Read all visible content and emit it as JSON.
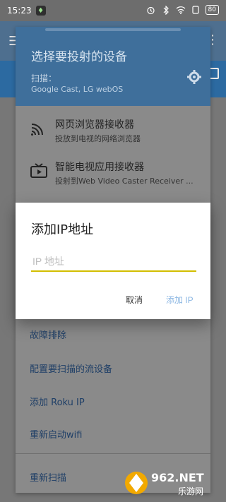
{
  "status_bar": {
    "time": "15:23",
    "notification_icon": "app-icon",
    "icons": [
      "alarm-icon",
      "bluetooth-icon",
      "wifi-icon",
      "sim-icon"
    ],
    "battery": "80"
  },
  "app_bar": {
    "menu_icon": "menu-icon",
    "more_icon": "more-vert-icon"
  },
  "sheet": {
    "title": "选择要投射的设备",
    "scan_label": "扫描：",
    "scan_value": "Google Cast, LG webOS",
    "receivers": [
      {
        "title": "网页浏览器接收器",
        "subtitle": "投放到电视的网络浏览器",
        "icon": "cast-icon"
      },
      {
        "title": "智能电视应用接收器",
        "subtitle": "投射到Web Video Caster Receiver ...",
        "icon": "tv-icon"
      }
    ],
    "options": [
      "故障排除",
      "配置要扫描的流设备",
      "添加 Roku IP",
      "重新启动wifi"
    ],
    "rescan": "重新扫描"
  },
  "dialog": {
    "title": "添加IP地址",
    "input_placeholder": "IP 地址",
    "input_value": "",
    "cancel_label": "取消",
    "add_label": "添加 IP",
    "accent": "#d2be00"
  },
  "watermark": {
    "brand": "962.NET",
    "sub": "乐游网"
  }
}
